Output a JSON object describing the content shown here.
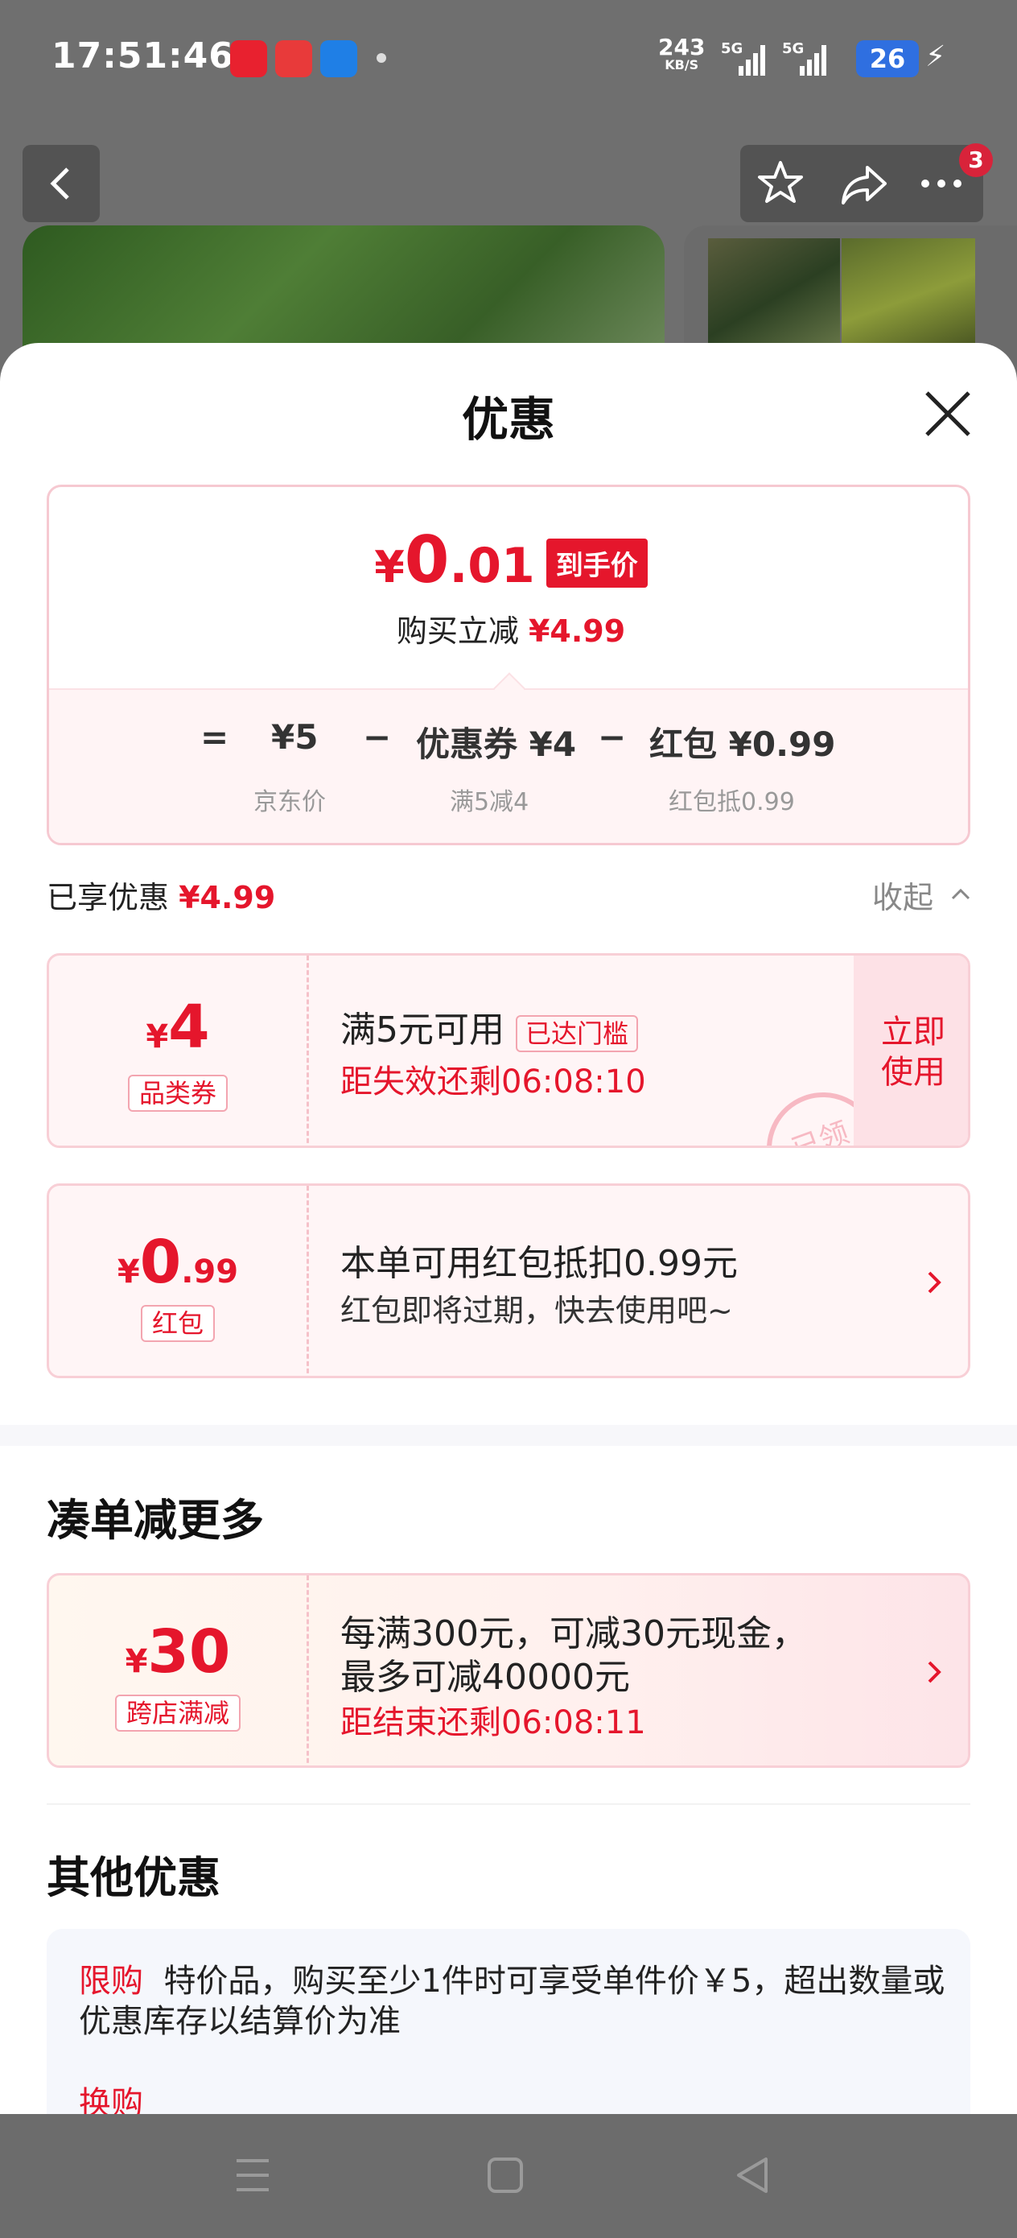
{
  "status_bar": {
    "time": "17:51:46",
    "net_speed": "243",
    "net_unit": "KB/S",
    "sig1": "5G",
    "sig2": "5G",
    "battery": "26"
  },
  "header": {
    "cart_badge": "3"
  },
  "sheet": {
    "title": "优惠",
    "price": {
      "currency": "¥",
      "integer": "0",
      "decimal": ".01",
      "tag": "到手价",
      "reduce_label": "购买立减",
      "reduce_value": "¥4.99"
    },
    "formula": {
      "eq": "=",
      "base": "¥5",
      "minus1": "−",
      "coupon": "优惠券 ¥4",
      "minus2": "−",
      "redpacket": "红包 ¥0.99",
      "base_label": "京东价",
      "coupon_label": "满5减4",
      "redpacket_label": "红包抵0.99"
    },
    "enjoyed_label": "已享优惠",
    "enjoyed_value": "¥4.99",
    "collapse_label": "收起",
    "coupon1": {
      "cur": "¥",
      "value": "4",
      "tag": "品类券",
      "title": "满5元可用",
      "threshold_tag": "已达门槛",
      "countdown": "距失效还剩06:08:10",
      "use_label_1": "立即",
      "use_label_2": "使用",
      "stamp": "已领"
    },
    "coupon2": {
      "cur": "¥",
      "int": "0",
      "dec": ".99",
      "tag": "红包",
      "title": "本单可用红包抵扣0.99元",
      "sub": "红包即将过期，快去使用吧~"
    },
    "more_title": "凑单减更多",
    "fullred": {
      "cur": "¥",
      "value": "30",
      "tag": "跨店满减",
      "line1": "每满300元，可减30元现金，",
      "line2": "最多可减40000元",
      "countdown": "距结束还剩06:08:11"
    },
    "other_title": "其他优惠",
    "other": {
      "limit_tag": "限购",
      "limit_text": "特价品，购买至少1件时可享受单件价￥5，超出数量或优惠库存以结算价为准",
      "swap_tag": "换购"
    }
  },
  "colors": {
    "accent": "#e5162c",
    "badge": "#d8233a",
    "battery": "#2f6fe0"
  }
}
